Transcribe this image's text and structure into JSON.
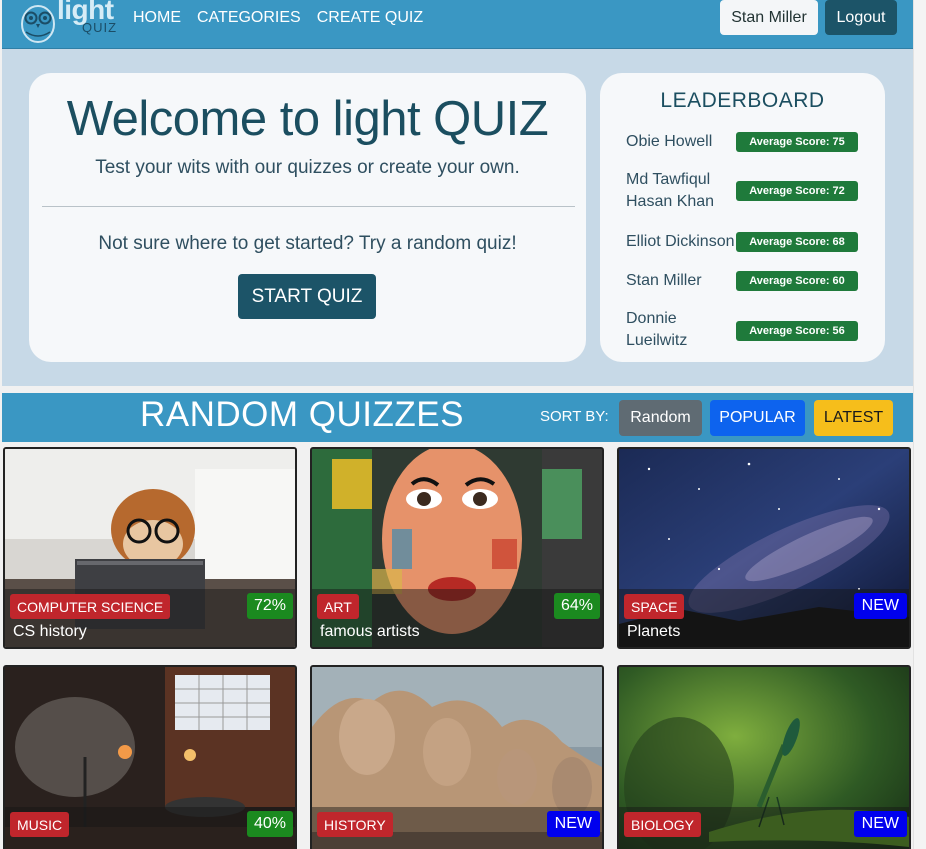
{
  "nav": {
    "logo_text": "light",
    "logo_sub": "QUIZ",
    "links": [
      "HOME",
      "CATEGORIES",
      "CREATE QUIZ"
    ],
    "user_label": "Stan Miller",
    "logout_label": "Logout"
  },
  "welcome": {
    "title": "Welcome to light QUIZ",
    "subtitle": "Test your wits with our quizzes or create your own.",
    "prompt": "Not sure where to get started? Try a random quiz!",
    "start_label": "START QUIZ"
  },
  "leaderboard": {
    "title": "LEADERBOARD",
    "entries": [
      {
        "name": "Obie Howell",
        "score": "Average Score: 75"
      },
      {
        "name": "Md Tawfiqul Hasan Khan",
        "score": "Average Score: 72"
      },
      {
        "name": "Elliot Dickinson",
        "score": "Average Score: 68"
      },
      {
        "name": "Stan Miller",
        "score": "Average Score: 60"
      },
      {
        "name": "Donnie Lueilwitz",
        "score": "Average Score: 56"
      }
    ]
  },
  "quizzes_section": {
    "title": "RANDOM QUIZZES",
    "sort_label": "SORT BY:",
    "sort_options": [
      "Random",
      "POPULAR",
      "LATEST"
    ]
  },
  "quizzes": [
    {
      "category": "COMPUTER SCIENCE",
      "name": "CS history",
      "badge": "72%",
      "badge_type": "percent"
    },
    {
      "category": "ART",
      "name": "famous artists",
      "badge": "64%",
      "badge_type": "percent"
    },
    {
      "category": "SPACE",
      "name": "Planets",
      "badge": "NEW",
      "badge_type": "new"
    },
    {
      "category": "MUSIC",
      "name": "",
      "badge": "40%",
      "badge_type": "percent"
    },
    {
      "category": "HISTORY",
      "name": "",
      "badge": "NEW",
      "badge_type": "new"
    },
    {
      "category": "BIOLOGY",
      "name": "",
      "badge": "NEW",
      "badge_type": "new"
    }
  ],
  "colors": {
    "navbar": "#3a97c3",
    "primary_dark": "#1c5468",
    "hero_band": "#c7d9e7",
    "score_green": "#1f7a3b",
    "category_red": "#c0262c",
    "new_blue": "#0000ee"
  }
}
